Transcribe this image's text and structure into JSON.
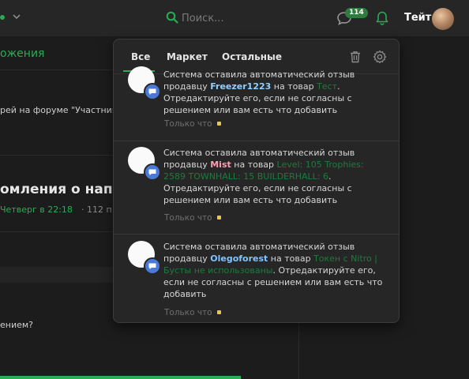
{
  "header": {
    "search_placeholder": "Поиск...",
    "messages_count": "114",
    "username": "Тейт"
  },
  "background": {
    "green_title": "ожения",
    "forum_text": "рей на форуме \"Участник",
    "thread_title": "омления о напис",
    "thread_date": "Четверг в 22:18",
    "thread_meta": "· 112 п",
    "question_text": "ением?"
  },
  "dropdown": {
    "tabs": [
      "Все",
      "Маркет",
      "Остальные"
    ],
    "top_partial": {
      "line1": "Система оставила автоматический отзыв",
      "prefix": "продавцу ",
      "seller": "Freezer1223",
      "mid": " на товар ",
      "product": "Тест",
      "suffix": ". Отредактируйте его, если не согласны с решением или вам есть что добавить",
      "time": "Только что"
    },
    "items": [
      {
        "line1": "Система оставила автоматический отзыв",
        "prefix": "продавцу ",
        "seller": "Mist",
        "mid": " на товар ",
        "product": "Level: 105 Trophies: 2589 TOWNHALL: 15 BUILDERHALL: 6",
        "suffix": ". Отредактируйте его, если не согласны с решением или вам есть что добавить",
        "time": "Только что"
      },
      {
        "line1": "Система оставила автоматический отзыв",
        "prefix": "продавцу ",
        "seller": "Olegoforest",
        "mid": " на товар ",
        "product": "Токен с Nitro | Бусты не использованы",
        "suffix": ". Отредактируйте его, если не согласны с решением или вам есть что добавить",
        "time": "Только что"
      }
    ]
  },
  "colors": {
    "accent_green": "#2bab55",
    "seller_freezer": "#8fd0ff",
    "seller_mist": "#ff9db4",
    "seller_olego": "#7fc4ff"
  }
}
